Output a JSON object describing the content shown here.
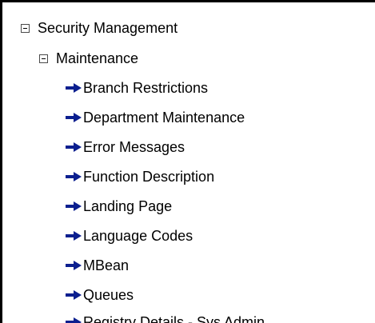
{
  "tree": {
    "root": {
      "label": "Security Management",
      "icon": "collapse-icon",
      "expanded": true
    },
    "group": {
      "label": "Maintenance",
      "icon": "collapse-icon",
      "expanded": true
    },
    "items": [
      {
        "label": "Branch Restrictions",
        "icon": "arrow-right-icon"
      },
      {
        "label": "Department Maintenance",
        "icon": "arrow-right-icon"
      },
      {
        "label": "Error Messages",
        "icon": "arrow-right-icon"
      },
      {
        "label": "Function Description",
        "icon": "arrow-right-icon"
      },
      {
        "label": "Landing Page",
        "icon": "arrow-right-icon"
      },
      {
        "label": "Language Codes",
        "icon": "arrow-right-icon"
      },
      {
        "label": "MBean",
        "icon": "arrow-right-icon"
      },
      {
        "label": "Queues",
        "icon": "arrow-right-icon"
      },
      {
        "label": "Registry Details - Sys Admin",
        "icon": "arrow-right-icon"
      }
    ],
    "colors": {
      "arrow": "#0b1f8f",
      "text": "#000000",
      "border": "#000000"
    }
  }
}
